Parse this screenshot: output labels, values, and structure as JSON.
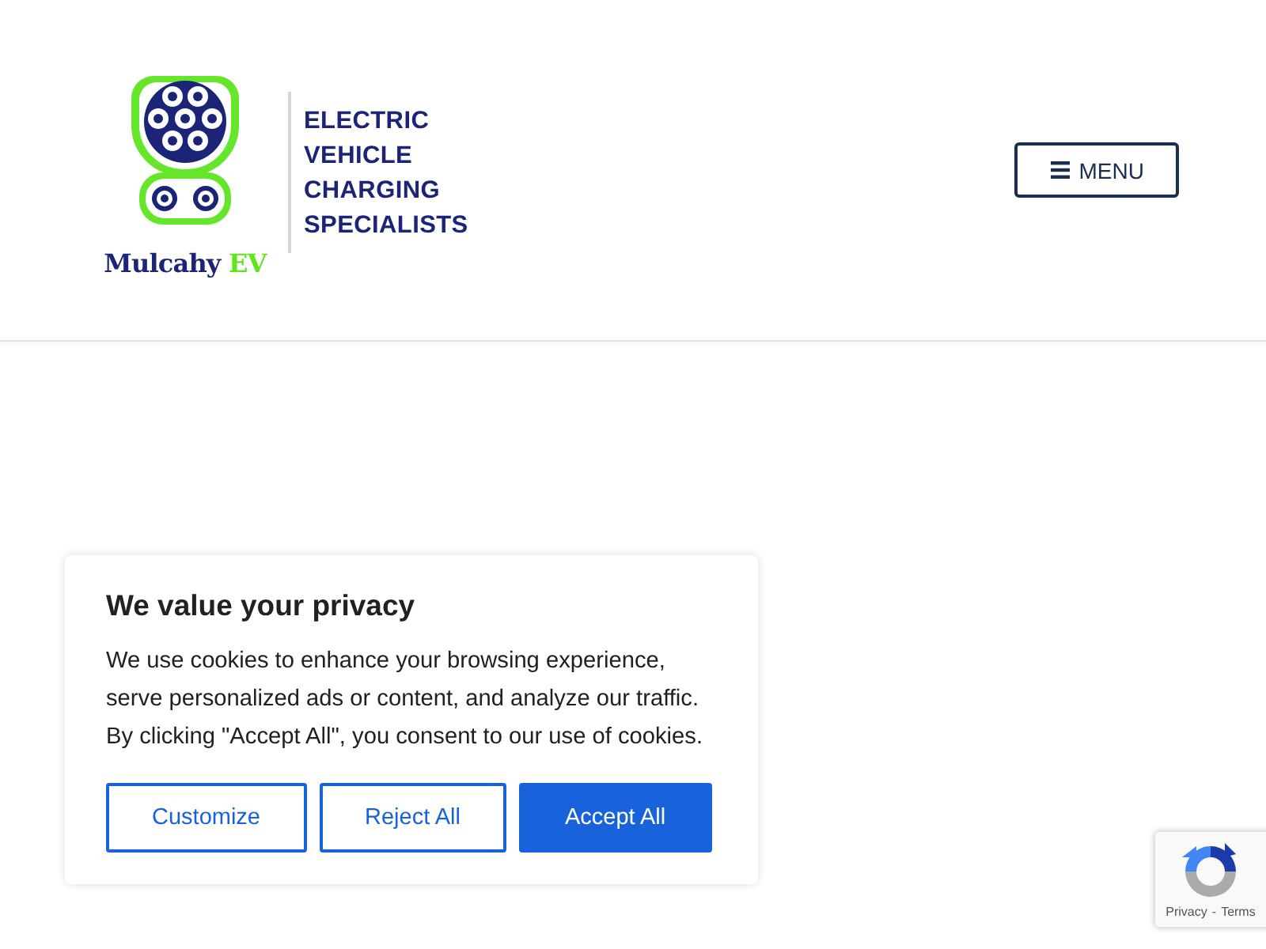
{
  "header": {
    "logo": {
      "brand": "Mulcahy",
      "brand_suffix": "EV",
      "tagline": [
        "ELECTRIC",
        "VEHICLE",
        "CHARGING",
        "SPECIALISTS"
      ]
    },
    "menu_button": {
      "label": "MENU"
    }
  },
  "cookie_banner": {
    "title": "We value your privacy",
    "text": "We use cookies to enhance your browsing experience, serve personalized ads or content, and analyze our traffic. By clicking \"Accept All\", you consent to our use of cookies.",
    "buttons": [
      {
        "label": "Customize",
        "kind": "outline"
      },
      {
        "label": "Reject All",
        "kind": "outline"
      },
      {
        "label": "Accept All",
        "kind": "filled"
      }
    ]
  },
  "recaptcha_badge": {
    "links": [
      "Privacy",
      "Terms"
    ],
    "separator": "-"
  }
}
